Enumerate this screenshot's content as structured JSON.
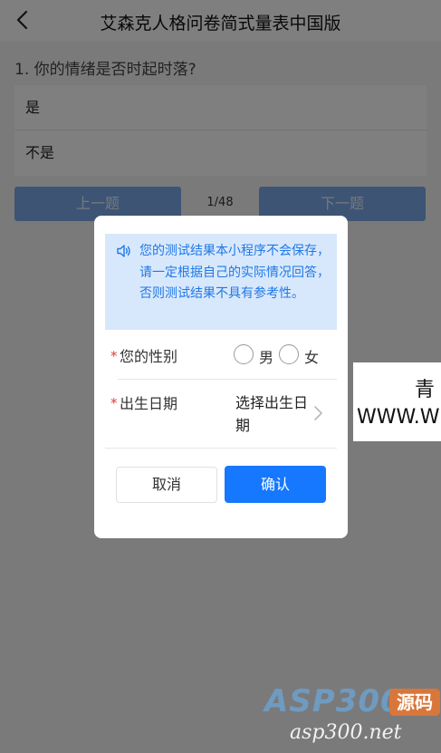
{
  "navbar": {
    "title": "艾森克人格问卷简式量表中国版",
    "back_icon": "chevron-left-icon"
  },
  "question": {
    "text": "1. 你的情绪是否时起时落?",
    "options": [
      "是",
      "不是"
    ]
  },
  "pager": {
    "prev_label": "上一题",
    "next_label": "下一题",
    "progress": "1/48"
  },
  "dialog": {
    "notice_icon": "speaker-icon",
    "notice": "您的测试结果本小程序不会保存，请一定根据自己的实际情况回答，否则测试结果不具有参考性。",
    "gender_label": "您的性别",
    "gender_options": [
      "男",
      "女"
    ],
    "birth_label": "出生日期",
    "birth_placeholder": "选择出生日期",
    "required_mark": "*",
    "cancel_label": "取消",
    "confirm_label": "确认"
  },
  "side_ad": {
    "line1": "青",
    "line2": "WWW.W"
  },
  "watermark": {
    "main": "ASP300",
    "tag": "源码",
    "sub": "asp300.net"
  },
  "colors": {
    "accent": "#1677ff",
    "notice_bg": "#d8e8fc",
    "notice_text": "#1f78e6",
    "required": "#e23b3b",
    "mask": "rgba(0,0,0,0.5)"
  }
}
